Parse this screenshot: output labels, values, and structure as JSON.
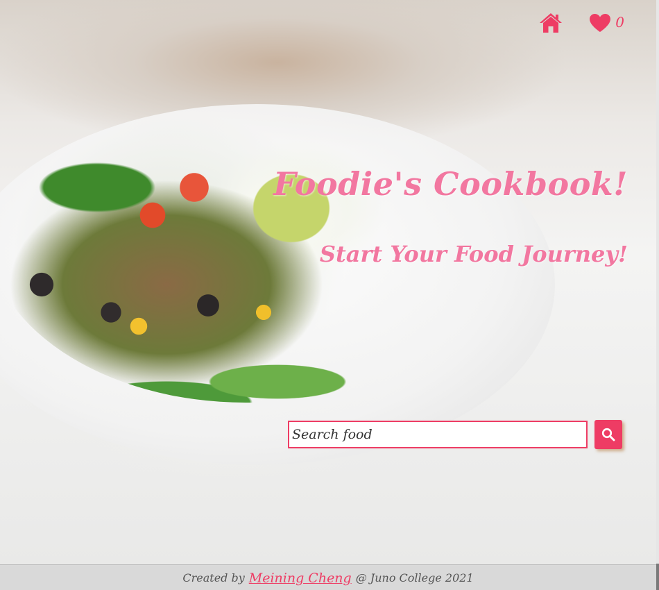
{
  "app": {
    "title": "Foodie's Cookbook!",
    "subtitle": "Start Your Food Journey!"
  },
  "header": {
    "home_icon": "home-icon",
    "favorites_icon": "heart-icon",
    "favorites_count": "0"
  },
  "search": {
    "placeholder": "Search food",
    "value": "",
    "button_icon": "search-icon"
  },
  "footer": {
    "prefix": "Created by",
    "author": "Meining Cheng",
    "suffix": "@ Juno College 2021"
  },
  "colors": {
    "accent": "#ee3c64",
    "title": "#f277a0",
    "footer_bg": "#d9d9d9"
  }
}
